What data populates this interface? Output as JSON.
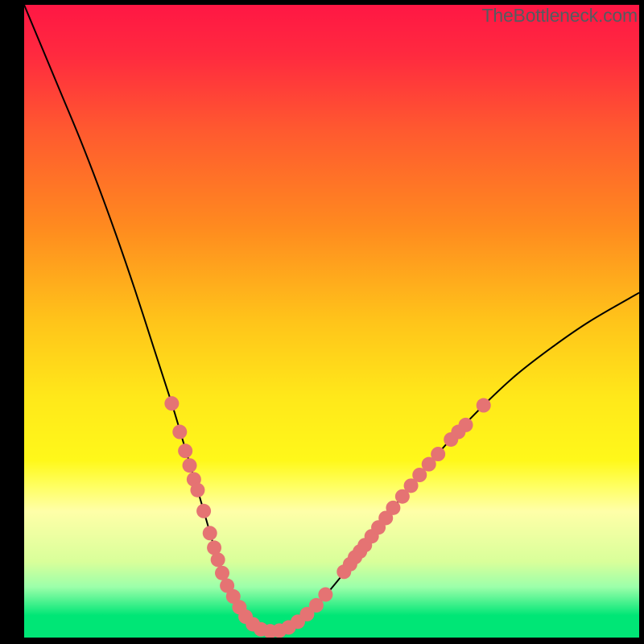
{
  "watermark": "TheBottleneck.com",
  "chart_data": {
    "type": "line",
    "title": "",
    "xlabel": "",
    "ylabel": "",
    "xlim": [
      0,
      100
    ],
    "ylim": [
      0,
      100
    ],
    "background_gradient": {
      "stops": [
        {
          "offset": 0.0,
          "color": "#ff1744"
        },
        {
          "offset": 0.08,
          "color": "#ff2a3f"
        },
        {
          "offset": 0.2,
          "color": "#ff5a2f"
        },
        {
          "offset": 0.35,
          "color": "#ff8a1f"
        },
        {
          "offset": 0.5,
          "color": "#ffc41a"
        },
        {
          "offset": 0.62,
          "color": "#ffe81a"
        },
        {
          "offset": 0.72,
          "color": "#fff81a"
        },
        {
          "offset": 0.76,
          "color": "#ffff60"
        },
        {
          "offset": 0.8,
          "color": "#ffffa8"
        },
        {
          "offset": 0.88,
          "color": "#d9ff9a"
        },
        {
          "offset": 0.92,
          "color": "#9cffaa"
        },
        {
          "offset": 0.965,
          "color": "#00e676"
        },
        {
          "offset": 1.0,
          "color": "#00e676"
        }
      ]
    },
    "series": [
      {
        "name": "bottleneck-curve",
        "color": "#000000",
        "stroke_width": 2,
        "x": [
          0,
          3,
          6,
          9,
          12,
          15,
          18,
          21,
          24,
          26,
          28,
          29.5,
          31,
          32.5,
          34,
          35.5,
          37,
          38.5,
          40,
          42,
          44,
          47,
          51,
          55,
          60,
          65,
          70,
          75,
          80,
          86,
          92,
          100
        ],
        "y": [
          100,
          93,
          86,
          79,
          71.5,
          63.5,
          55,
          46,
          37,
          30.5,
          24,
          19,
          14,
          10,
          6.5,
          4,
          2.2,
          1.2,
          1,
          1.1,
          2,
          4.5,
          9,
          14,
          20.5,
          26.5,
          32,
          37,
          41.5,
          46,
          50,
          54.5
        ]
      }
    ],
    "marker_groups": [
      {
        "name": "highlight-markers",
        "color": "#e57373",
        "radius": 9,
        "points": [
          {
            "x": 24.0,
            "y": 37.0
          },
          {
            "x": 25.3,
            "y": 32.5
          },
          {
            "x": 26.2,
            "y": 29.5
          },
          {
            "x": 26.9,
            "y": 27.2
          },
          {
            "x": 27.6,
            "y": 25.0
          },
          {
            "x": 28.2,
            "y": 23.3
          },
          {
            "x": 29.2,
            "y": 20.0
          },
          {
            "x": 30.2,
            "y": 16.5
          },
          {
            "x": 30.9,
            "y": 14.2
          },
          {
            "x": 31.5,
            "y": 12.3
          },
          {
            "x": 32.2,
            "y": 10.2
          },
          {
            "x": 33.0,
            "y": 8.2
          },
          {
            "x": 34.0,
            "y": 6.5
          },
          {
            "x": 35.0,
            "y": 4.8
          },
          {
            "x": 36.0,
            "y": 3.3
          },
          {
            "x": 37.2,
            "y": 2.1
          },
          {
            "x": 38.5,
            "y": 1.3
          },
          {
            "x": 40.0,
            "y": 1.0
          },
          {
            "x": 41.5,
            "y": 1.1
          },
          {
            "x": 43.0,
            "y": 1.6
          },
          {
            "x": 44.5,
            "y": 2.5
          },
          {
            "x": 46.0,
            "y": 3.7
          },
          {
            "x": 47.5,
            "y": 5.1
          },
          {
            "x": 49.0,
            "y": 6.8
          },
          {
            "x": 52.0,
            "y": 10.4
          },
          {
            "x": 53.0,
            "y": 11.6
          },
          {
            "x": 53.8,
            "y": 12.7
          },
          {
            "x": 54.6,
            "y": 13.6
          },
          {
            "x": 55.4,
            "y": 14.6
          },
          {
            "x": 56.5,
            "y": 16.0
          },
          {
            "x": 57.6,
            "y": 17.4
          },
          {
            "x": 58.8,
            "y": 18.9
          },
          {
            "x": 60.0,
            "y": 20.5
          },
          {
            "x": 61.5,
            "y": 22.3
          },
          {
            "x": 62.9,
            "y": 24.0
          },
          {
            "x": 64.3,
            "y": 25.7
          },
          {
            "x": 65.8,
            "y": 27.4
          },
          {
            "x": 67.3,
            "y": 29.0
          },
          {
            "x": 69.4,
            "y": 31.3
          },
          {
            "x": 70.6,
            "y": 32.5
          },
          {
            "x": 71.8,
            "y": 33.6
          },
          {
            "x": 74.7,
            "y": 36.7
          }
        ]
      }
    ]
  }
}
